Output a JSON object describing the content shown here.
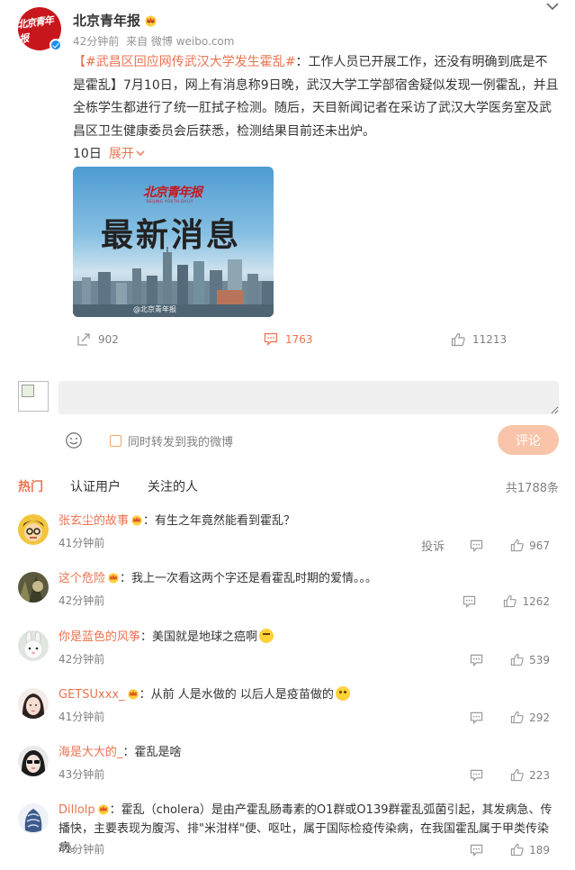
{
  "post": {
    "author": "北京青年报",
    "avatar_text": "北京青年报",
    "time": "42分钟前",
    "source": "来自 微博 weibo.com",
    "topic": "【#武昌区回应网传武汉大学发生霍乱#",
    "body": "：工作人员已开展工作，还没有明确到底是不是霍乱】7月10日，网上有消息称9日晚，武汉大学工学部宿舍疑似发现一例霍乱，并且全栋学生都进行了统一肛拭子检测。随后，天目新闻记者在采访了武汉大学医务室及武昌区卫生健康委员会后获悉，检测结果目前还未出炉。",
    "date": "10日",
    "expand": "展开",
    "image": {
      "logo": "北京青年报",
      "logo_sub": "BEIJING YOUTH DAILY",
      "title": "最新消息",
      "watermark": "@北京青年报"
    },
    "repost_count": "902",
    "comment_count": "1763",
    "like_count": "11213"
  },
  "composer": {
    "placeholder": "",
    "also_repost_label": "同时转发到我的微博",
    "submit_label": "评论"
  },
  "tabs": {
    "hot": "热门",
    "verified": "认证用户",
    "following": "关注的人",
    "total": "共1788条"
  },
  "comments": [
    {
      "user": "张玄尘的故事",
      "crown": true,
      "text": "：有生之年竟然能看到霍乱？",
      "emoji": "",
      "time": "41分钟前",
      "report": "投诉",
      "likes": "967"
    },
    {
      "user": "这个危险",
      "crown": true,
      "text": "：我上一次看这两个字还是看霍乱时期的爱情。。。",
      "emoji": "",
      "time": "42分钟前",
      "report": "",
      "likes": "1262"
    },
    {
      "user": "你是蓝色的风筝",
      "crown": false,
      "text": "：美国就是地球之癌啊",
      "emoji": "cry",
      "time": "42分钟前",
      "report": "",
      "likes": "539"
    },
    {
      "user": "GETSUxxx_",
      "crown": true,
      "text": "：从前 人是水做的 以后人是疫苗做的",
      "emoji": "smile",
      "time": "41分钟前",
      "report": "",
      "likes": "292"
    },
    {
      "user": "海是大大的_",
      "crown": false,
      "text": "：霍乱是啥",
      "emoji": "",
      "time": "43分钟前",
      "report": "",
      "likes": "223"
    },
    {
      "user": "Dillolp",
      "crown": true,
      "text": "：霍乱（cholera）是由产霍乱肠毒素的O1群或O139群霍乱弧菌引起，其发病急、传播快，主要表现为腹泻、排\"米泔样\"便、呕吐，属于国际检疫传染病，在我国霍乱属于甲类传染病。",
      "emoji": "",
      "time": "42分钟前",
      "report": "",
      "likes": "189"
    }
  ],
  "colors": {
    "accent": "#eb7350",
    "brand_red": "#c8161d",
    "verified_blue": "#1a8bf0",
    "submit_disabled": "#f9c4a9"
  }
}
